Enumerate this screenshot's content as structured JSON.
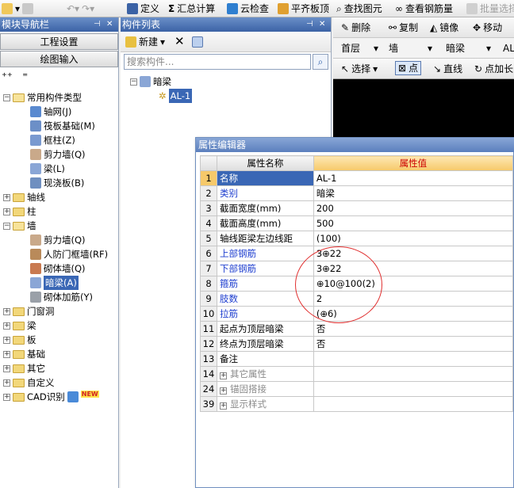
{
  "toolbar": {
    "define": "定义",
    "sum_calc": "汇总计算",
    "cloud_check": "云检查",
    "level_slab": "平齐板顶",
    "find_element": "查找图元",
    "view_rebar": "查看钢筋量",
    "batch_select": "批量选择"
  },
  "nav": {
    "title": "模块导航栏",
    "project_settings": "工程设置",
    "drawing_input": "绘图输入",
    "tree": {
      "common_types": "常用构件类型",
      "axis_grid": "轴网(J)",
      "raft_foundation": "筏板基础(M)",
      "frame_column": "框柱(Z)",
      "shear_wall": "剪力墙(Q)",
      "beam": "梁(L)",
      "cast_slab": "现浇板(B)",
      "axis_line": "轴线",
      "column": "柱",
      "wall": "墙",
      "wall_shear": "剪力墙(Q)",
      "civil_defense_wall": "人防门框墙(RF)",
      "masonry_wall": "砌体墙(Q)",
      "hidden_beam": "暗梁(A)",
      "masonry_rebar": "砌体加筋(Y)",
      "door_window": "门窗洞",
      "beam_group": "梁",
      "slab": "板",
      "foundation": "基础",
      "other": "其它",
      "custom": "自定义",
      "cad_recognition": "CAD识别",
      "new_badge": "NEW"
    }
  },
  "comp_list": {
    "title": "构件列表",
    "new_label": "新建",
    "search_placeholder": "搜索构件...",
    "tree_root": "暗梁",
    "tree_item": "AL-1"
  },
  "draw": {
    "delete": "删除",
    "copy": "复制",
    "mirror": "镜像",
    "move": "移动",
    "floor": "首层",
    "wall": "墙",
    "hidden_beam": "暗梁",
    "al_short": "AL",
    "select": "选择",
    "point": "点",
    "line": "直线",
    "point_extend": "点加长"
  },
  "prop_editor": {
    "title": "属性编辑器",
    "col_name": "属性名称",
    "col_value": "属性值",
    "rows": [
      {
        "num": "1",
        "name": "名称",
        "value": "AL-1"
      },
      {
        "num": "2",
        "name": "类别",
        "value": "暗梁"
      },
      {
        "num": "3",
        "name": "截面宽度(mm)",
        "value": "200"
      },
      {
        "num": "4",
        "name": "截面高度(mm)",
        "value": "500"
      },
      {
        "num": "5",
        "name": "轴线距梁左边线距",
        "value": "(100)"
      },
      {
        "num": "6",
        "name": "上部钢筋",
        "value": "3⊕22"
      },
      {
        "num": "7",
        "name": "下部钢筋",
        "value": "3⊕22"
      },
      {
        "num": "8",
        "name": "箍筋",
        "value": "⊕10@100(2)"
      },
      {
        "num": "9",
        "name": "肢数",
        "value": "2"
      },
      {
        "num": "10",
        "name": "拉筋",
        "value": "(⊕6)"
      },
      {
        "num": "11",
        "name": "起点为顶层暗梁",
        "value": "否"
      },
      {
        "num": "12",
        "name": "终点为顶层暗梁",
        "value": "否"
      },
      {
        "num": "13",
        "name": "备注",
        "value": ""
      },
      {
        "num": "14",
        "name": "其它属性",
        "value": ""
      },
      {
        "num": "24",
        "name": "锚固搭接",
        "value": ""
      },
      {
        "num": "39",
        "name": "显示样式",
        "value": ""
      }
    ]
  },
  "colors": {
    "header_blue": "#3b62a5",
    "selection": "#3a67b5",
    "value_header": "#f6c96a",
    "annotation": "#e03030"
  }
}
